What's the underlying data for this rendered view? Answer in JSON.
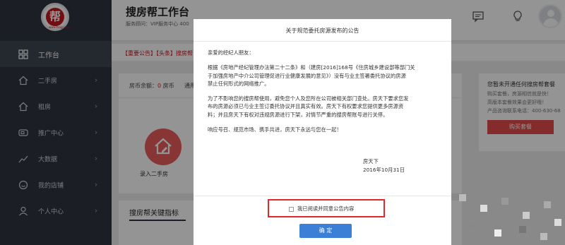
{
  "sidebar": {
    "logo_char": "帮",
    "logo_url": "www.fang.com",
    "items": [
      {
        "label": "工作台",
        "icon": "grid-icon",
        "active": true
      },
      {
        "label": "二手房",
        "icon": "house-icon"
      },
      {
        "label": "租房",
        "icon": "house-icon"
      },
      {
        "label": "推广中心",
        "icon": "ticket-icon"
      },
      {
        "label": "大数据",
        "icon": "chart-line-icon"
      },
      {
        "label": "我的店铺",
        "icon": "shop-icon"
      },
      {
        "label": "个人中心",
        "icon": "user-icon"
      }
    ]
  },
  "header": {
    "title": "搜房帮工作台",
    "subtitle": "服务顾问：VIP服务中心 400"
  },
  "main": {
    "notice": "【重要公告】【头条】搜房帮",
    "balance_label": "房币余额：",
    "balance_value": "0",
    "balance_unit": "房币",
    "balance_extra": "通用",
    "action_label": "录入二手房",
    "kpi_title": "搜房帮关键指标"
  },
  "right_panel": {
    "title": "您暂未开通任何搜房帮套餐",
    "lines": [
      "购买套餐，房源相信就是快！",
      "高版本套餐效果会更好哦！",
      "产品咨询联系电话：400-630-68"
    ],
    "buy_label": "购买套餐"
  },
  "modal": {
    "title": "关于规范委托房源发布的公告",
    "greeting": "亲爱的经纪人朋友：",
    "para1": [
      "根据《房地产经纪管理办法第二十二条》和（建房[2016]168号《住房城乡建设部等部门关",
      "于加强房地产中介公司管理促进行业健康发展的意见》）没有与业主签署委托协议的房源",
      "禁止任何形式的网络推广。"
    ],
    "para2": [
      "为了不影响您的搜房帮使用，避免您个人及您所在公司被相关部门查处。房天下要求您发",
      "布的房源必须已与业主签订委托协议并且真实有效。房天下有权要求您提供更多房源资",
      "料；并且房天下有权对违规房源进行下架，对情节严重的搜房帮账号进行关停。"
    ],
    "para3": "响应号召、规范市场、携手共进，房天下永远与您在一起！",
    "signer": "房天下",
    "date": "2016年10月31日",
    "agree_label": "我已阅读并同意公告内容",
    "agree_checked": false,
    "confirm_label": "确 定"
  },
  "colors": {
    "sidebar_bg": "#2f3640",
    "accent_red": "#c8171e",
    "confirm_blue": "#3b7fd6",
    "highlight_border": "#e0282a"
  }
}
